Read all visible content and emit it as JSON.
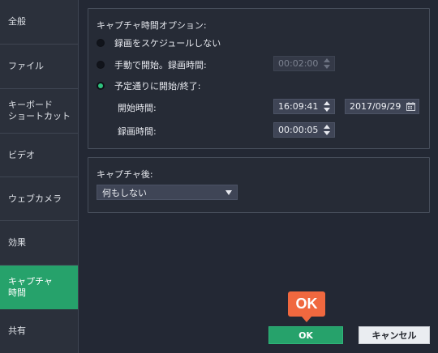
{
  "sidebar": {
    "items": [
      {
        "label": "全般"
      },
      {
        "label": "ファイル"
      },
      {
        "label": "キーボード\nショートカット"
      },
      {
        "label": "ビデオ"
      },
      {
        "label": "ウェブカメラ"
      },
      {
        "label": "効果"
      },
      {
        "label": "キャプチャ\n時間"
      },
      {
        "label": "共有"
      }
    ],
    "active_index": 6
  },
  "options": {
    "title": "キャプチャ時間オプション:",
    "radio_none": "録画をスケジュールしない",
    "radio_manual": "手動で開始。録画時間:",
    "manual_duration": "00:02:00",
    "radio_scheduled": "予定通りに開始/終了:",
    "start_label": "開始時間:",
    "start_time": "16:09:41",
    "start_date": "2017/09/29",
    "record_label": "録画時間:",
    "record_duration": "00:00:05",
    "selected": "scheduled"
  },
  "after": {
    "title": "キャプチャ後:",
    "action": "何もしない"
  },
  "buttons": {
    "ok": "OK",
    "cancel": "キャンセル"
  },
  "callout": {
    "label": "OK"
  },
  "colors": {
    "accent_green": "#26a26b",
    "callout_orange": "#f0683f",
    "background": "#232834"
  }
}
